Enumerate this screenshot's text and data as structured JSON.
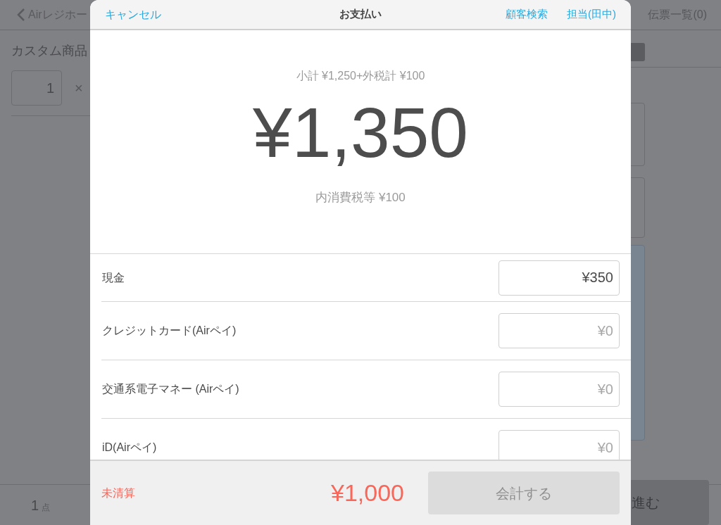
{
  "background": {
    "back_link": "Airレジホー",
    "slips_link": "伝票一覧(0)",
    "item_title": "カスタム商品",
    "quantity": "1",
    "times": "×",
    "count": "1",
    "count_unit": "点",
    "proceed_button": "進む"
  },
  "dialog": {
    "cancel": "キャンセル",
    "title": "お支払い",
    "customer_search": "顧客検索",
    "staff": "担当(田中)",
    "subtotal": "小計 ¥1,250+外税計 ¥100",
    "total": "¥1,350",
    "tax_note": "内消費税等 ¥100",
    "payments": [
      {
        "label": "現金",
        "value": "¥350"
      },
      {
        "label": "クレジットカード(Airペイ)",
        "placeholder": "¥0"
      },
      {
        "label": "交通系電子マネー (Airペイ)",
        "placeholder": "¥0"
      },
      {
        "label": "iD(Airペイ)",
        "placeholder": "¥0"
      }
    ],
    "status": "未清算",
    "remaining": "¥1,000",
    "checkout_button": "会計する",
    "checkout_disabled": true
  }
}
